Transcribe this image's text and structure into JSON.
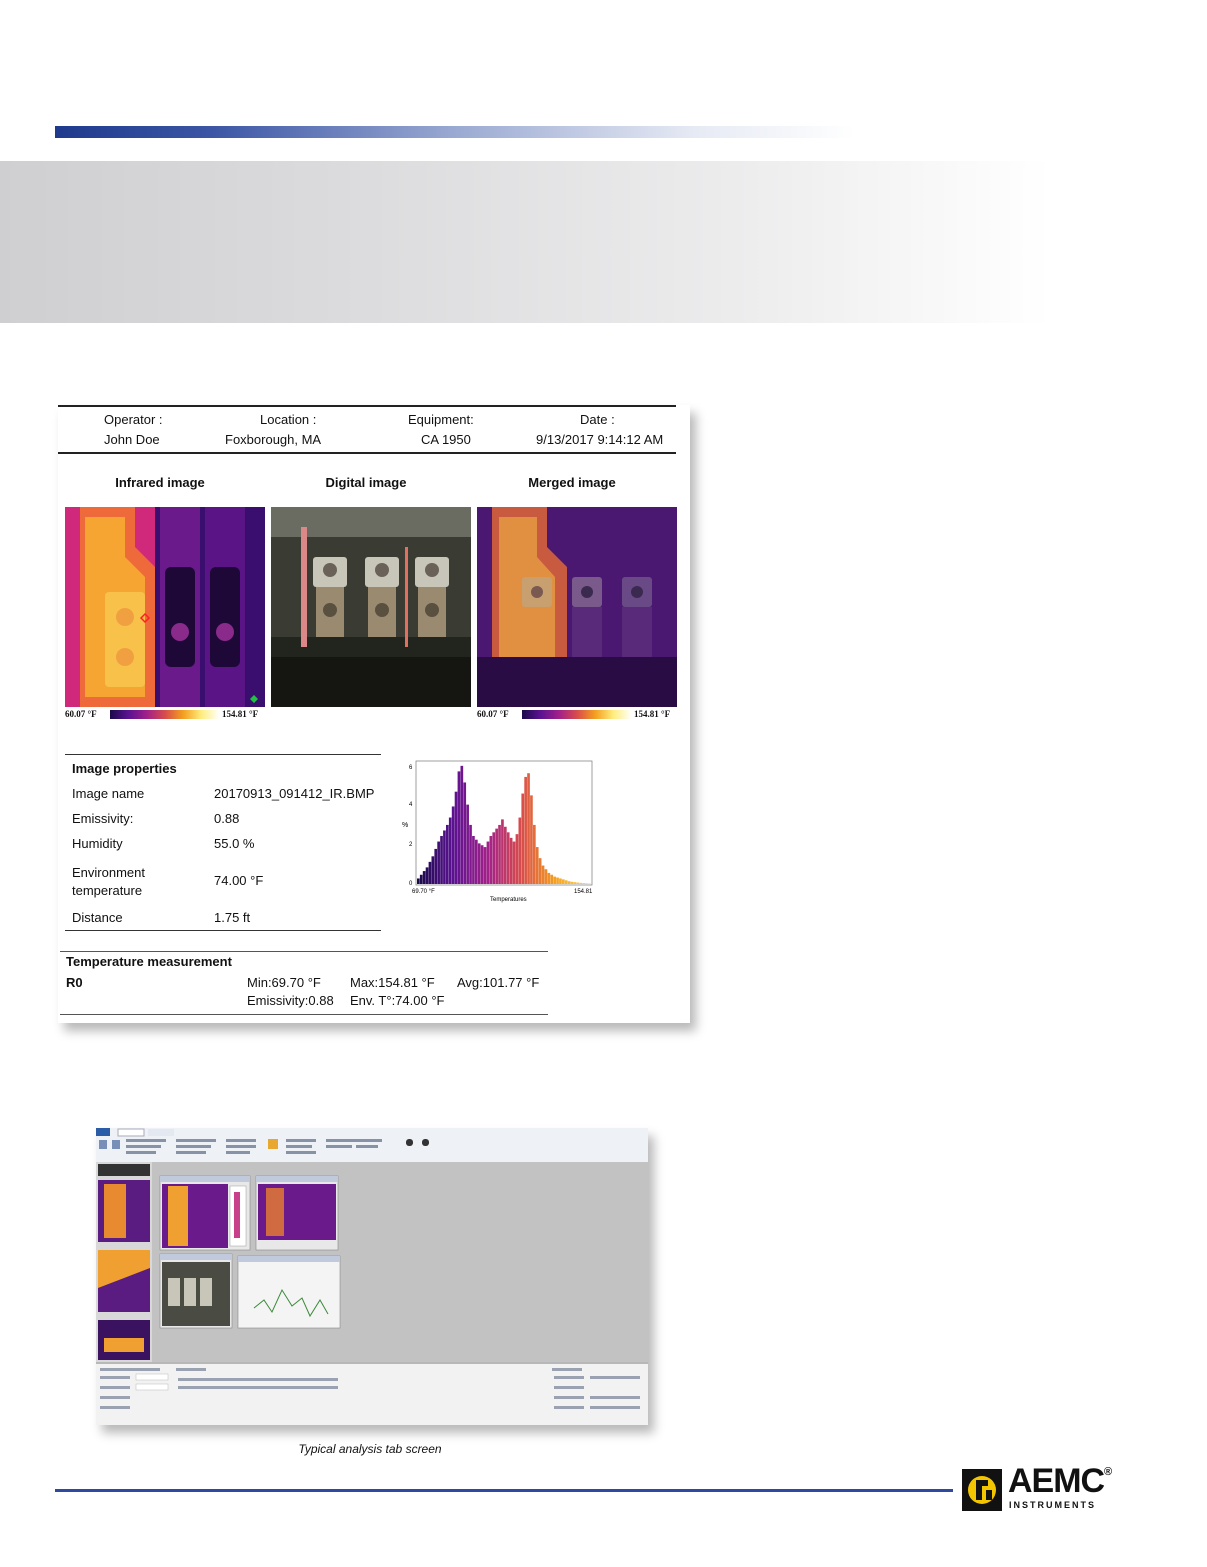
{
  "report": {
    "header_labels": [
      "Operator :",
      "Location :",
      "Equipment:",
      "Date :"
    ],
    "header_values": [
      "John Doe",
      "Foxborough, MA",
      "CA 1950",
      "9/13/2017 9:14:12 AM"
    ],
    "image_captions": [
      "Infrared image",
      "Digital image",
      "Merged image"
    ],
    "scale_min": "60.07 °F",
    "scale_max": "154.81 °F",
    "properties": {
      "title": "Image properties",
      "rows": [
        {
          "label": "Image name",
          "value": "20170913_091412_IR.BMP"
        },
        {
          "label": "Emissivity:",
          "value": "0.88"
        },
        {
          "label": "Humidity",
          "value": "55.0 %"
        },
        {
          "label": "Environment temperature",
          "value": "74.00 °F"
        },
        {
          "label": "Distance",
          "value": "1.75 ft"
        }
      ]
    },
    "histogram": {
      "ylabel": "%",
      "xlabel": "Temperatures",
      "xmin_label": "69.70 °F",
      "xmax_label": "154.81",
      "yticks": [
        "0",
        "2",
        "4",
        "6"
      ]
    },
    "temperature": {
      "title": "Temperature measurement",
      "region": "R0",
      "min": "Min:69.70 °F",
      "max": "Max:154.81 °F",
      "avg": "Avg:101.77 °F",
      "emissivity": "Emissivity:0.88",
      "env": "Env. T°:74.00 °F"
    }
  },
  "screenshot_caption": "Typical analysis tab screen",
  "logo": {
    "name": "AEMC",
    "reg": "®",
    "sub": "INSTRUMENTS"
  },
  "colors": {
    "brand_blue": "#2d4a9e",
    "logo_yellow": "#f2c500"
  },
  "chart_data": {
    "type": "bar",
    "title": "",
    "xlabel": "Temperatures",
    "ylabel": "%",
    "ylim": [
      0,
      6.5
    ],
    "x_range_labels": [
      "69.70 °F",
      "154.81"
    ],
    "values": [
      0.3,
      0.5,
      0.7,
      0.9,
      1.2,
      1.5,
      1.9,
      2.3,
      2.6,
      2.9,
      3.2,
      3.6,
      4.2,
      5.0,
      6.1,
      6.4,
      5.5,
      4.3,
      3.2,
      2.6,
      2.4,
      2.2,
      2.1,
      2.0,
      2.3,
      2.6,
      2.8,
      3.0,
      3.2,
      3.5,
      3.1,
      2.8,
      2.5,
      2.3,
      2.7,
      3.6,
      4.9,
      5.8,
      6.0,
      4.8,
      3.2,
      2.0,
      1.4,
      1.0,
      0.8,
      0.6,
      0.5,
      0.4,
      0.35,
      0.3,
      0.25,
      0.2,
      0.15,
      0.12,
      0.1,
      0.08,
      0.06,
      0.05,
      0.04,
      0.03
    ]
  }
}
